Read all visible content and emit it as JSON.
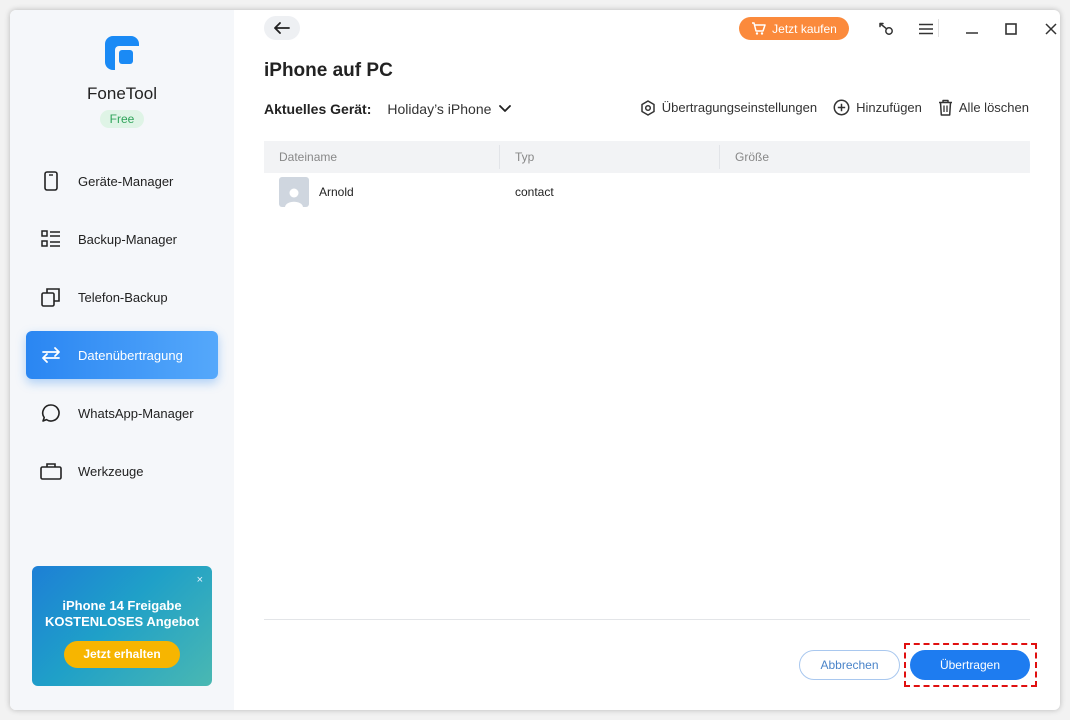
{
  "app": {
    "name": "FoneTool",
    "plan": "Free"
  },
  "sidebar": {
    "items": [
      {
        "label": "Geräte-Manager",
        "icon": "phone-icon"
      },
      {
        "label": "Backup-Manager",
        "icon": "list-icon"
      },
      {
        "label": "Telefon-Backup",
        "icon": "copy-icon"
      },
      {
        "label": "Datenübertragung",
        "icon": "transfer-arrows-icon",
        "active": true
      },
      {
        "label": "WhatsApp-Manager",
        "icon": "chat-bubble-icon"
      },
      {
        "label": "Werkzeuge",
        "icon": "toolbox-icon"
      }
    ]
  },
  "promo": {
    "line1": "iPhone 14 Freigabe",
    "line2": "KOSTENLOSES Angebot",
    "cta": "Jetzt erhalten",
    "close": "×"
  },
  "header": {
    "buy_label": "Jetzt kaufen"
  },
  "page": {
    "title": "iPhone auf PC"
  },
  "device": {
    "label": "Aktuelles Gerät:",
    "selected": "Holiday’s iPhone"
  },
  "actions": {
    "settings": "Übertragungseinstellungen",
    "add": "Hinzufügen",
    "clear": "Alle löschen"
  },
  "table": {
    "columns": [
      "Dateiname",
      "Typ",
      "Größe"
    ],
    "rows": [
      {
        "name": "Arnold",
        "type": "contact",
        "size": ""
      }
    ]
  },
  "footer": {
    "cancel": "Abbrechen",
    "transfer": "Übertragen"
  },
  "colors": {
    "accent": "#1e7cf0",
    "buy": "#fb8a3c",
    "promo_cta": "#f7b500",
    "highlight": "#e01010",
    "badge_bg": "#dff4e6",
    "badge_text": "#2fa35a"
  }
}
